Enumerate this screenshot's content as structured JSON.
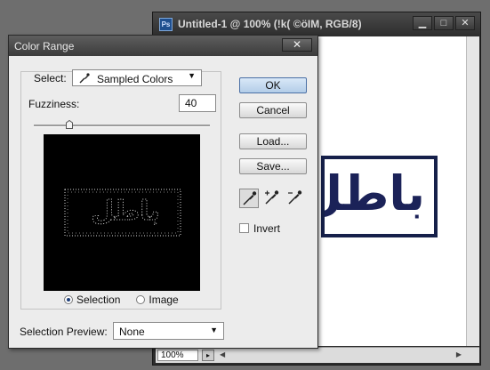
{
  "document": {
    "title": "Untitled-1 @ 100% (!k( ©öIM, RGB/8)",
    "app_icon": "Ps",
    "zoom": "100%",
    "canvas_text": "باطل",
    "win_buttons": {
      "minimize": "▁",
      "maximize": "□",
      "close": "✕"
    }
  },
  "dialog": {
    "title": "Color Range",
    "close": "✕",
    "select_label": "Select:",
    "select_value": "Sampled Colors",
    "fuzziness_label": "Fuzziness:",
    "fuzziness_value": "40",
    "fuzziness_slider": 0.2,
    "view_options": [
      {
        "label": "Selection",
        "selected": true
      },
      {
        "label": "Image",
        "selected": false
      }
    ],
    "preview_label": "Selection Preview:",
    "preview_value": "None",
    "buttons": {
      "ok": "OK",
      "cancel": "Cancel",
      "load": "Load...",
      "save": "Save..."
    },
    "eyedroppers": [
      "eyedropper-icon",
      "eyedropper-plus-icon",
      "eyedropper-minus-icon"
    ],
    "invert_label": "Invert",
    "invert_checked": false
  },
  "colors": {
    "text_navy": "#1b2258",
    "ok_blue": "#b3cde8",
    "titlebar": "#3c3c3c"
  }
}
